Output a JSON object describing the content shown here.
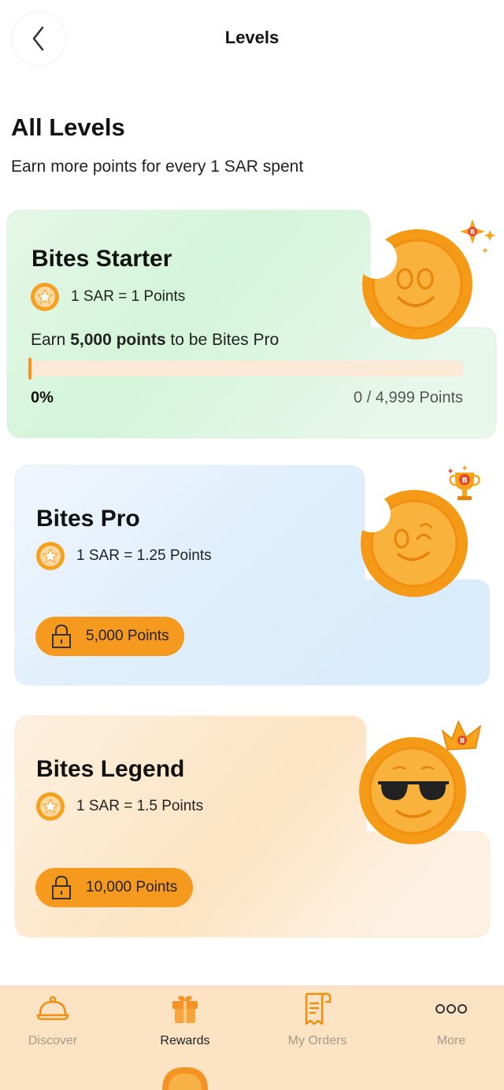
{
  "header": {
    "title": "Levels",
    "back_icon": "chevron-left-icon"
  },
  "intro": {
    "title": "All Levels",
    "subtitle": "Earn more points for every 1 SAR spent"
  },
  "levels": [
    {
      "name": "Bites Starter",
      "rate": "1 SAR = 1 Points",
      "earn_prefix": "Earn ",
      "earn_bold": "5,000 points",
      "earn_suffix": " to be Bites Pro",
      "progress_percent": 0,
      "progress_label": "0%",
      "points_count": "0 / 4,999 Points",
      "mascot": "smiling-coin-icon",
      "badge": "sparkle-badge-icon",
      "theme": "#d8f5dc"
    },
    {
      "name": "Bites Pro",
      "rate": "1 SAR = 1.25 Points",
      "unlock_label": "5,000 Points",
      "mascot": "winking-coin-icon",
      "badge": "trophy-badge-icon",
      "theme": "#dcedfb"
    },
    {
      "name": "Bites Legend",
      "rate": "1 SAR = 1.5 Points",
      "unlock_label": "10,000 Points",
      "mascot": "sunglasses-coin-icon",
      "badge": "crown-badge-icon",
      "theme": "#fde6c8"
    }
  ],
  "nav": {
    "items": [
      {
        "label": "Discover",
        "icon": "cloche-icon",
        "active": false
      },
      {
        "label": "Rewards",
        "icon": "gift-icon",
        "active": true
      },
      {
        "label": "My Orders",
        "icon": "receipt-icon",
        "active": false
      },
      {
        "label": "More",
        "icon": "more-dots-icon",
        "active": false
      }
    ]
  },
  "colors": {
    "accent": "#f69a1f",
    "coin": "#f5a01e",
    "nav_bg": "#fbe3c4"
  }
}
